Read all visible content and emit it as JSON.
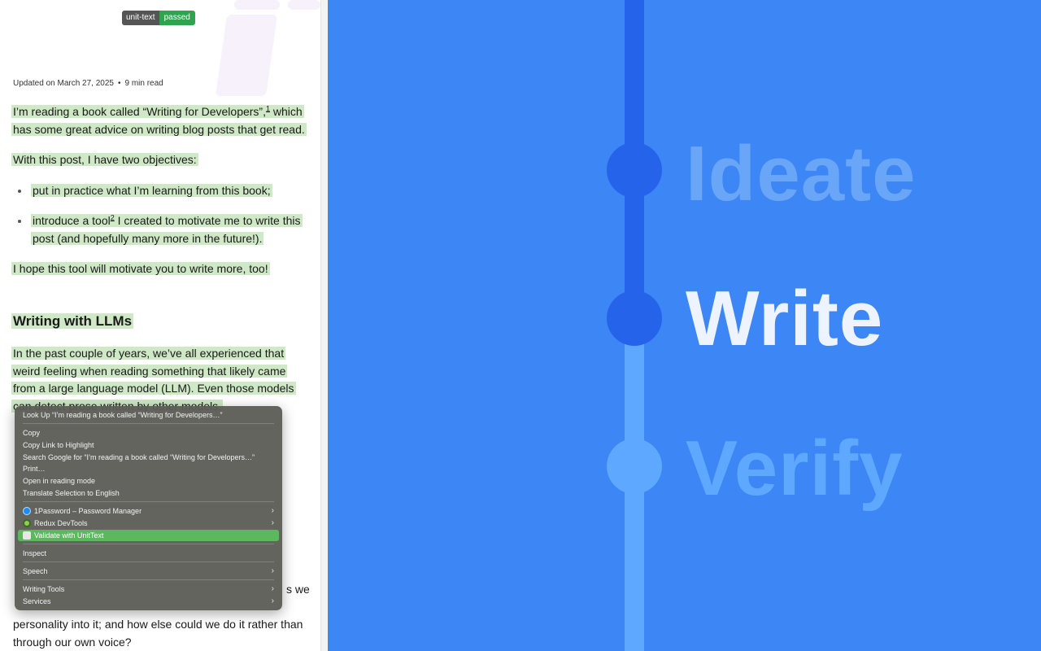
{
  "badge": {
    "label": "unit-text",
    "status": "passed"
  },
  "meta": {
    "updated": "Updated on March 27, 2025",
    "read_time": "9 min read"
  },
  "article": {
    "p1a": "I’m reading a book called “Writing for Developers”,",
    "fn1": "1",
    "p1b": " which has some great advice on writing blog posts that get read.",
    "p2": "With this post, I have two objectives:",
    "li1": "put in practice what I’m learning from this book;",
    "li2a": "introduce a tool",
    "fn2": "2",
    "li2b": " I created to motivate me to write this post (and hopefully many more in the future!).",
    "p3": "I hope this tool will motivate you to write more, too!",
    "heading": "Writing with LLMs",
    "p4": "In the past couple of years, we’ve all experienced that weird feeling when reading something that likely came from a large language model (LLM). Even those models can detect prose written by other models.",
    "p5_tail1": "s we",
    "p5_tail2": "personality into it; and how else could we do it rather than through our own voice?"
  },
  "hero": {
    "words": [
      "Ideate",
      "Write",
      "Verify"
    ],
    "colors": {
      "background": "#3d86f5",
      "dark_blue": "#2563eb",
      "light_blue": "#5fa8ff",
      "faded_text": "#6aa6f8",
      "active_text": "#eef4ff"
    }
  },
  "context_menu": {
    "look_up": "Look Up “I’m reading a book called “Writing for Developers…”",
    "copy": "Copy",
    "copy_link": "Copy Link to Highlight",
    "search": "Search Google for “I’m reading a book called “Writing for Developers…”",
    "print": "Print…",
    "reading_mode": "Open in reading mode",
    "translate": "Translate Selection to English",
    "onepassword": "1Password – Password Manager",
    "redux": "Redux DevTools",
    "validate": "Validate with UnitText",
    "inspect": "Inspect",
    "speech": "Speech",
    "writing_tools": "Writing Tools",
    "services": "Services",
    "submenu_arrow": "›"
  }
}
